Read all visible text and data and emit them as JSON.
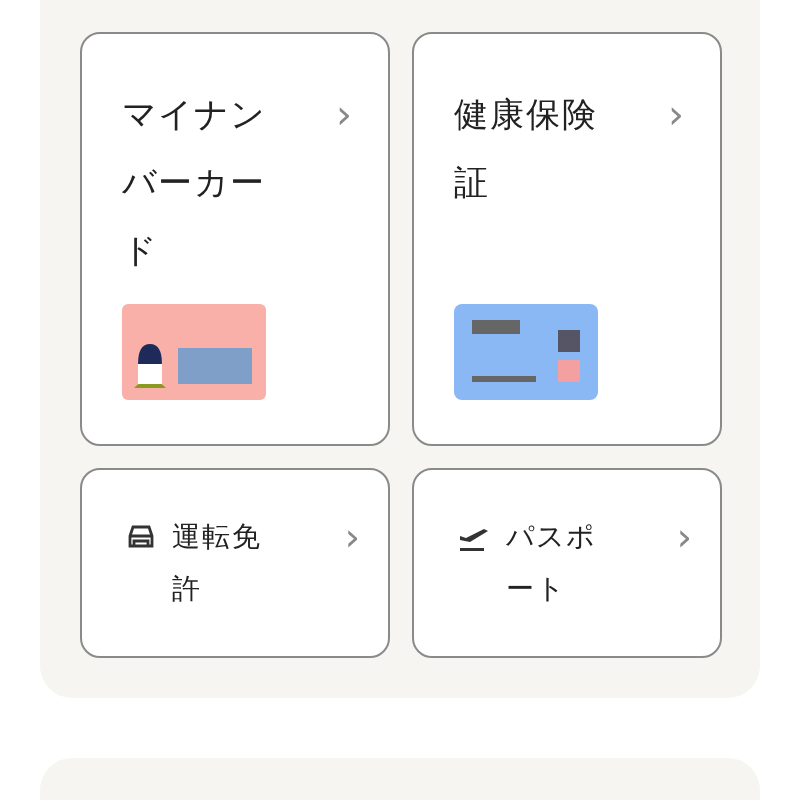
{
  "cards": [
    {
      "kind": "idcard",
      "label": "マイナンバーカード",
      "chevron": "›"
    },
    {
      "kind": "insurance",
      "label": "健康保険証",
      "chevron": "›"
    },
    {
      "kind": "car",
      "label": "運転免許",
      "chevron": "›"
    },
    {
      "kind": "plane",
      "label": "パスポート",
      "chevron": "›"
    }
  ]
}
